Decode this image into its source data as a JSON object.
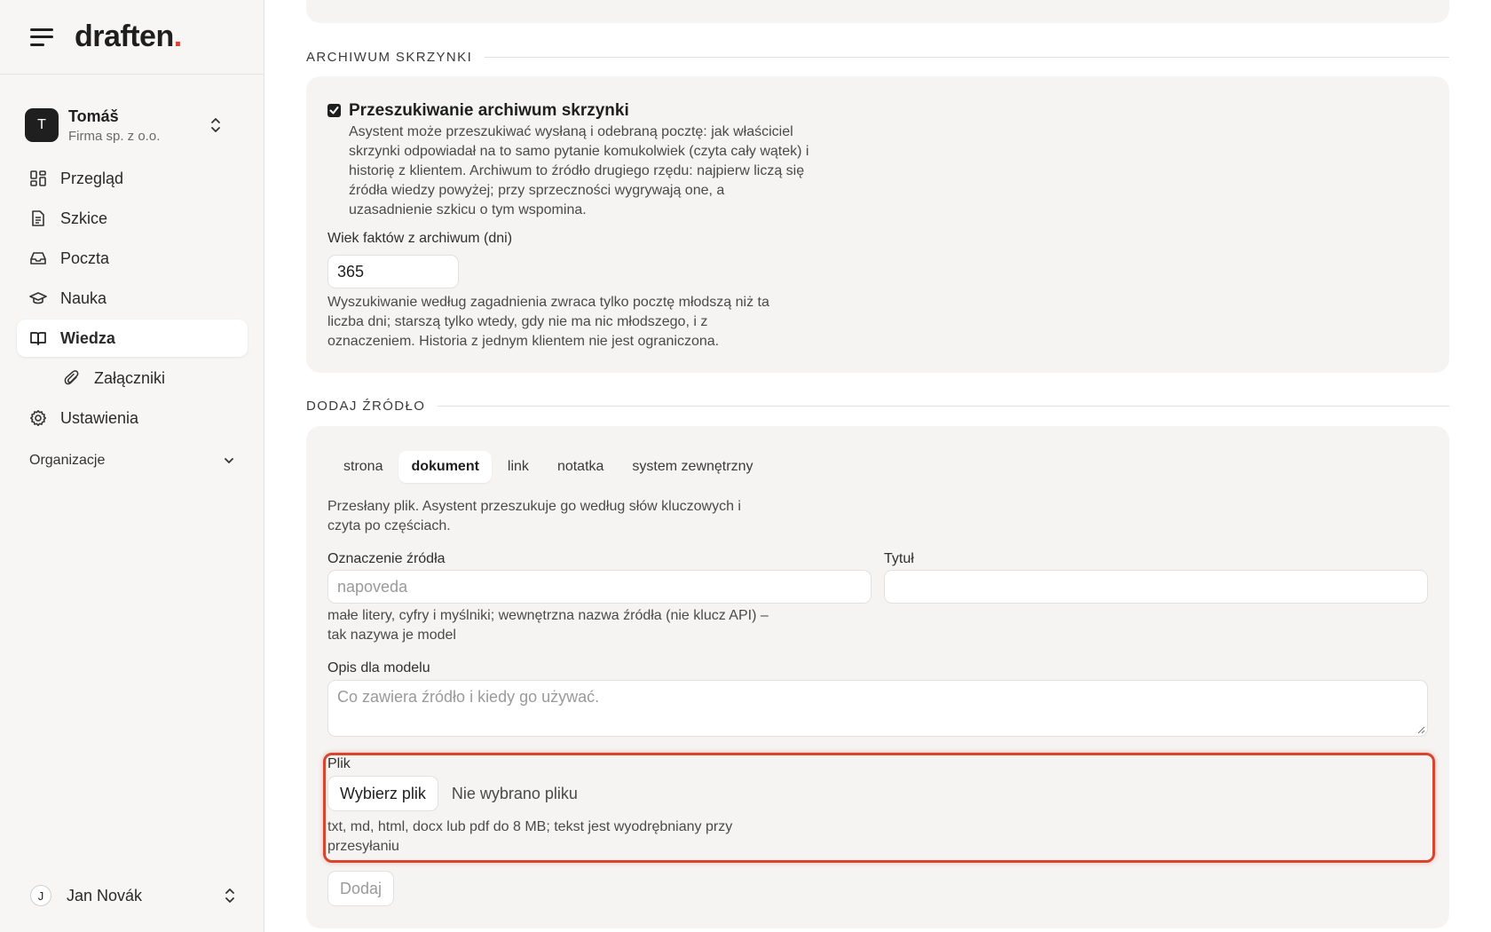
{
  "brand": {
    "name": "draften",
    "dot": "."
  },
  "account": {
    "initial": "T",
    "name": "Tomáš",
    "org": "Firma sp. z o.o."
  },
  "nav": {
    "overview": "Przegląd",
    "drafts": "Szkice",
    "mail": "Poczta",
    "learning": "Nauka",
    "knowledge": "Wiedza",
    "attachments": "Załączniki",
    "settings": "Ustawienia",
    "organizations": "Organizacje"
  },
  "user": {
    "initial": "J",
    "name": "Jan Novák"
  },
  "archive": {
    "section_title": "ARCHIWUM SKRZYNKI",
    "checkbox_label": "Przeszukiwanie archiwum skrzynki",
    "checked": true,
    "description": "Asystent może przeszukiwać wysłaną i odebraną pocztę: jak właściciel skrzynki odpowiadał na to samo pytanie komukolwiek (czyta cały wątek) i historię z klientem. Archiwum to źródło drugiego rzędu: najpierw liczą się źródła wiedzy powyżej; przy sprzeczności wygrywają one, a uzasadnienie szkicu o tym wspomina.",
    "age_label": "Wiek faktów z archiwum (dni)",
    "age_value": "365",
    "age_help": "Wyszukiwanie według zagadnienia zwraca tylko pocztę młodszą niż ta liczba dni; starszą tylko wtedy, gdy nie ma nic młodszego, i z oznaczeniem. Historia z jednym klientem nie jest ograniczona."
  },
  "add_source": {
    "section_title": "DODAJ ŹRÓDŁO",
    "tabs": [
      "strona",
      "dokument",
      "link",
      "notatka",
      "system zewnętrzny"
    ],
    "active_tab": "dokument",
    "description": "Przesłany plik. Asystent przeszukuje go według słów kluczowych i czyta po częściach.",
    "id_label": "Oznaczenie źródła",
    "id_placeholder": "napoveda",
    "title_label": "Tytuł",
    "title_value": "",
    "id_help": "małe litery, cyfry i myślniki; wewnętrzna nazwa źródła (nie klucz API) – tak nazywa je model",
    "desc_label": "Opis dla modelu",
    "desc_placeholder": "Co zawiera źródło i kiedy go używać.",
    "file_label": "Plik",
    "file_button": "Wybierz plik",
    "file_status": "Nie wybrano pliku",
    "file_help": "txt, md, html, docx lub pdf do 8 MB; tekst jest wyodrębniany przy przesyłaniu",
    "submit": "Dodaj"
  },
  "colors": {
    "accent": "#d9442f",
    "sidebar_bg": "#f7f6f5",
    "card_bg": "#f5f4f2"
  }
}
